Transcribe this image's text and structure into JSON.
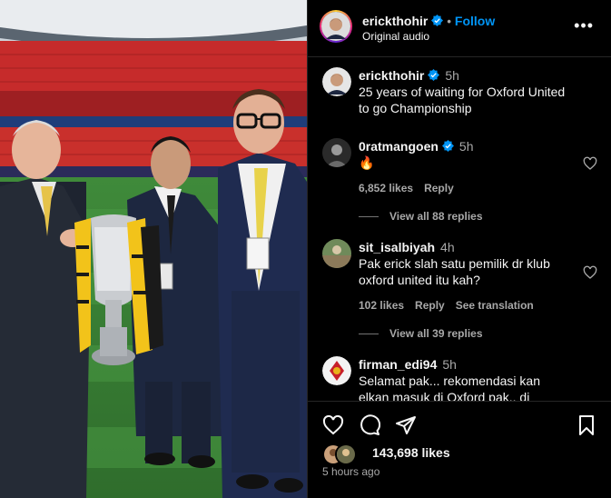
{
  "header": {
    "username": "erickthohir",
    "follow_label": "Follow",
    "separator": "•",
    "audio": "Original audio",
    "more": "•••"
  },
  "caption": {
    "username": "erickthohir",
    "time": "5h",
    "text": "25 years of waiting for Oxford United to go Championship"
  },
  "comments": [
    {
      "username": "0ratmangoen",
      "time": "5h",
      "text": "🔥",
      "likes": "6,852 likes",
      "reply_label": "Reply",
      "view_replies": "View all 88 replies"
    },
    {
      "username": "sit_isalbiyah",
      "time": "4h",
      "text": "Pak erick slah satu pemilik dr klub oxford united itu kah?",
      "likes": "102 likes",
      "reply_label": "Reply",
      "translate_label": "See translation",
      "view_replies": "View all 39 replies"
    },
    {
      "username": "firman_edi94",
      "time": "5h",
      "text": "Selamat pak... rekomendasi kan elkan masuk di Oxford pak.. di"
    }
  ],
  "footer": {
    "likes": "143,698 likes",
    "time_ago": "5 hours ago"
  },
  "icons": {
    "like": "heart-icon",
    "comment": "comment-icon",
    "share": "send-icon",
    "save": "bookmark-icon",
    "verified": "verified-badge-icon"
  },
  "colors": {
    "accent": "#0095f6",
    "background": "#000000",
    "muted": "#a8a8a8"
  }
}
